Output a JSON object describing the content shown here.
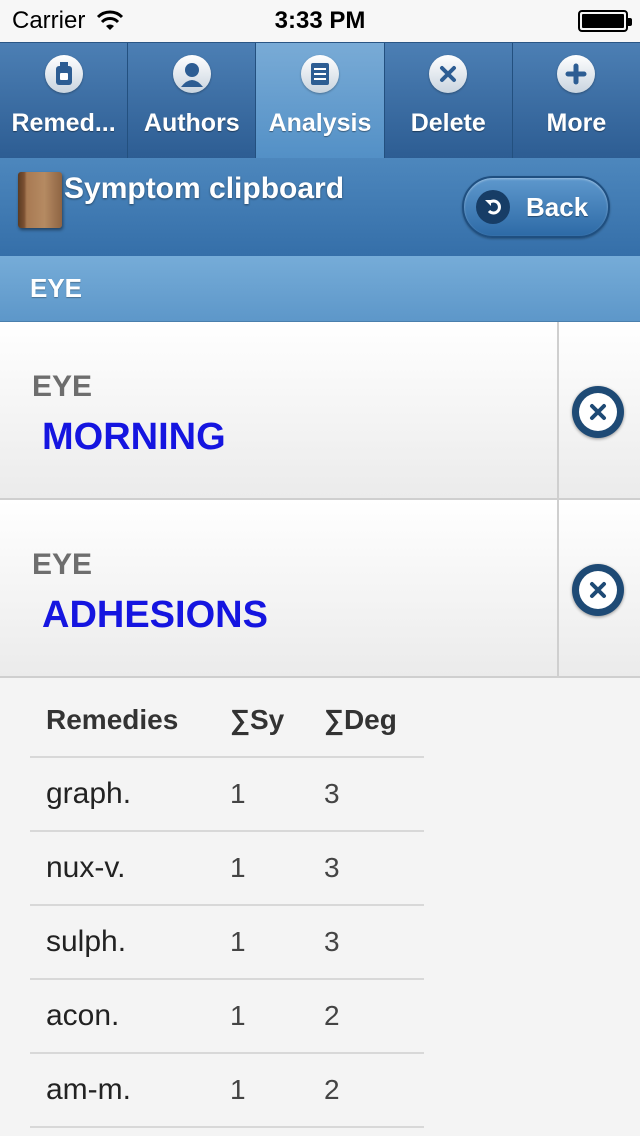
{
  "status_bar": {
    "carrier": "Carrier",
    "time": "3:33 PM"
  },
  "tabs": [
    {
      "label": "Remed...",
      "icon": "remedies-bottle-icon",
      "active": false
    },
    {
      "label": "Authors",
      "icon": "person-icon",
      "active": false
    },
    {
      "label": "Analysis",
      "icon": "analysis-notepad-icon",
      "active": true
    },
    {
      "label": "Delete",
      "icon": "delete-x-icon",
      "active": false
    },
    {
      "label": "More",
      "icon": "plus-icon",
      "active": false
    }
  ],
  "header": {
    "title": "Symptom clipboard",
    "back_label": "Back"
  },
  "section": {
    "label": "EYE"
  },
  "symptoms": [
    {
      "category": "EYE",
      "name": "MORNING"
    },
    {
      "category": "EYE",
      "name": "ADHESIONS"
    }
  ],
  "table": {
    "headers": [
      "Remedies",
      "∑Sy",
      "∑Deg"
    ],
    "rows": [
      [
        "graph.",
        "1",
        "3"
      ],
      [
        "nux-v.",
        "1",
        "3"
      ],
      [
        "sulph.",
        "1",
        "3"
      ],
      [
        "acon.",
        "1",
        "2"
      ],
      [
        "am-m.",
        "1",
        "2"
      ]
    ]
  },
  "colors": {
    "tab_bar": "#2d5d93",
    "active_tab": "#5390c6",
    "symptom_text": "#1515e0",
    "category_text": "#6e6e6e"
  }
}
